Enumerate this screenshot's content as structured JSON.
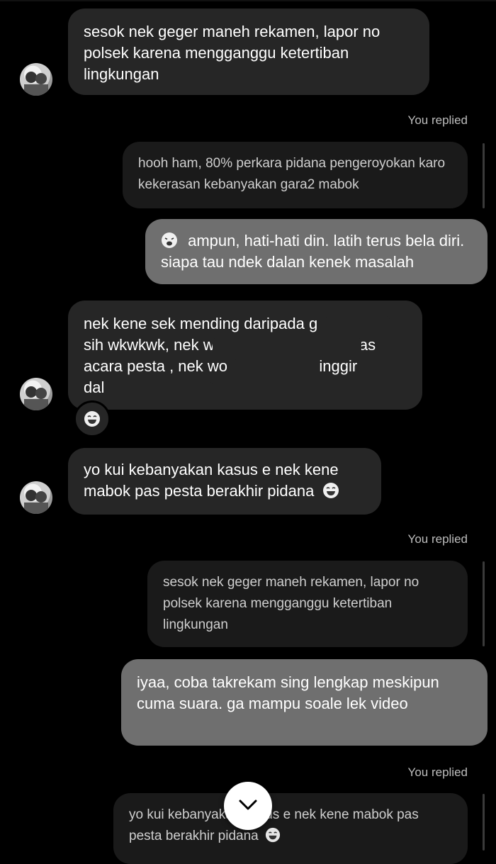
{
  "messages": {
    "m1_text": "sesok nek geger maneh rekamen, lapor no polsek karena mengganggu ketertiban lingkungan",
    "replied_label_1": "You replied",
    "reply_quote_1": "hooh ham, 80% perkara pidana pengeroyokan karo kekerasan kebanyakan gara2 mabok",
    "out_1": "ampun, hati-hati din. latih terus bela diri. siapa tau ndek dalan kenek masalah",
    "m2_line1": "nek kene sek mending daripada g",
    "m2_line2a": "sih wkwkwk, nek w",
    "m2_line2b": "pas",
    "m2_line3a": "acara pesta , nek wo",
    "m2_line3b": "k pinggir",
    "m2_line4": "dal",
    "m3_text": "yo kui kebanyakan kasus e nek kene mabok pas pesta berakhir pidana",
    "replied_label_2": "You replied",
    "reply_quote_2": "sesok nek geger maneh rekamen, lapor no polsek karena mengganggu ketertiban lingkungan",
    "out_2": "iyaa, coba takrekam sing lengkap meskipun cuma suara. ga mampu soale lek video",
    "replied_label_3": "You replied",
    "reply_quote_3": "yo kui kebanyakan kasus e nek kene mabok pas pesta berakhir pidana"
  },
  "icons": {
    "reaction": "laughing-face-emoji",
    "weary": "weary-face-emoji",
    "scroll": "chevron-down-icon"
  },
  "colors": {
    "background": "#000000",
    "incoming_bubble": "#262626",
    "outgoing_bubble": "#6f6f6f",
    "reply_quote_bubble": "#1a1a1a"
  }
}
